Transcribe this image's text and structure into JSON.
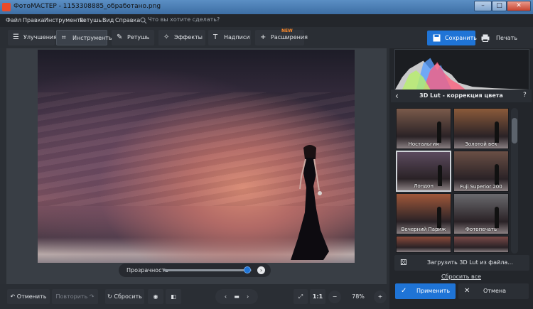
{
  "window": {
    "title": "ФотоМАСТЕР - 1153308885_обработано.png",
    "minimize": "–",
    "maximize": "□",
    "close": "✕"
  },
  "menu": {
    "items": [
      "Файл",
      "Правка",
      "Инструменты",
      "Ретушь",
      "Вид",
      "Справка"
    ],
    "search_placeholder": "Что вы хотите сделать?"
  },
  "tabs": [
    {
      "label": "Улучшения",
      "icon": "sliders-icon"
    },
    {
      "label": "Инструменты",
      "icon": "crop-icon"
    },
    {
      "label": "Ретушь",
      "icon": "brush-icon"
    },
    {
      "label": "Эффекты",
      "icon": "magic-wand-icon"
    },
    {
      "label": "Надписи",
      "icon": "text-icon"
    },
    {
      "label": "Расширения",
      "icon": "plus-icon"
    }
  ],
  "new_badge": "NEW",
  "actions": {
    "save": "Сохранить",
    "print": "Печать"
  },
  "opacity": {
    "label": "Прозрачность",
    "value": 0.95
  },
  "bottom": {
    "undo": "Отменить",
    "redo": "Повторить",
    "reset": "Сбросить",
    "ratio": "1:1",
    "zoom": "78%"
  },
  "lut": {
    "title": "3D Lut - коррекция цвета",
    "help": "?",
    "back": "‹",
    "items": [
      {
        "name": "Ностальгия",
        "tone": "#7a5a4a"
      },
      {
        "name": "Золотой век",
        "tone": "#8a5a3a"
      },
      {
        "name": "Лондон",
        "tone": "#5b4a5e",
        "selected": true
      },
      {
        "name": "Fuji Superior 200",
        "tone": "#6a4f45"
      },
      {
        "name": "Вечерний Париж",
        "tone": "#a0583a"
      },
      {
        "name": "Фотопечать",
        "tone": "#6a6a6e"
      },
      {
        "name": "",
        "tone": "#8a4a3a"
      },
      {
        "name": "",
        "tone": "#7a4a48"
      }
    ],
    "load": "Загрузить 3D Lut из файла...",
    "reset_all": "Сбросить все",
    "apply": "Применить",
    "cancel": "Отмена"
  }
}
